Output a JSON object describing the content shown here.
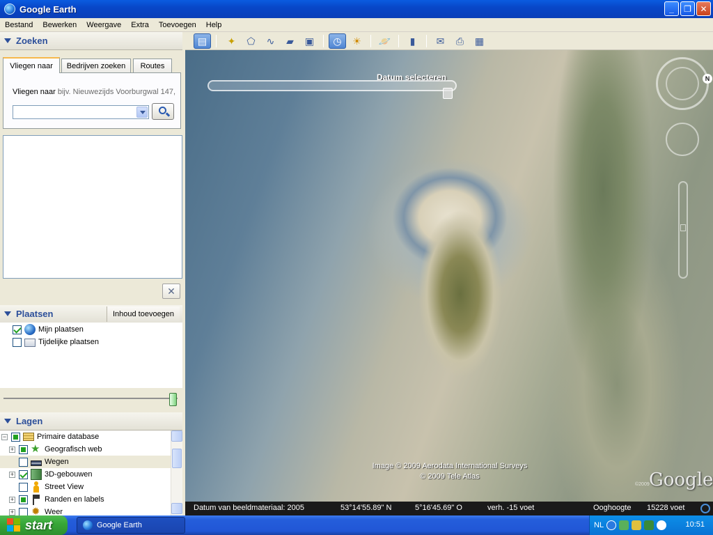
{
  "window": {
    "title": "Google Earth"
  },
  "menu": [
    "Bestand",
    "Bewerken",
    "Weergave",
    "Extra",
    "Toevoegen",
    "Help"
  ],
  "search": {
    "header": "Zoeken",
    "tabs": [
      "Vliegen naar",
      "Bedrijven zoeken",
      "Routes"
    ],
    "fly_label": "Vliegen naar",
    "fly_hint": "bijv. Nieuwezijds Voorburgwal 147,"
  },
  "places": {
    "header": "Plaatsen",
    "add_content": "Inhoud toevoegen",
    "items": [
      "Mijn plaatsen",
      "Tijdelijke plaatsen"
    ]
  },
  "layers": {
    "header": "Lagen",
    "items": [
      "Primaire database",
      "Geografisch web",
      "Wegen",
      "3D-gebouwen",
      "Street View",
      "Randen en labels",
      "Weer"
    ]
  },
  "map": {
    "date_label": "Datum selecteren",
    "copyright_1": "Image © 2009 Aerodata International Surveys",
    "copyright_2": "© 2009 Tele Atlas",
    "logo": "Google",
    "logo_year": "©2009",
    "compass_n": "N"
  },
  "status": {
    "imagery_date": "Datum van beeldmateriaal: 2005",
    "lat": "53°14'55.89\" N",
    "lon": "5°16'45.69\" O",
    "elev": "verh.  -15 voet",
    "eye_alt_label": "Ooghoogte",
    "eye_alt": "15228 voet"
  },
  "taskbar": {
    "start": "start",
    "task": "Google Earth",
    "lang": "NL",
    "clock": "10:51"
  },
  "colors": {
    "accent": "#2c4f9a",
    "titlebar": "#0a5ce0",
    "start": "#38a838"
  }
}
